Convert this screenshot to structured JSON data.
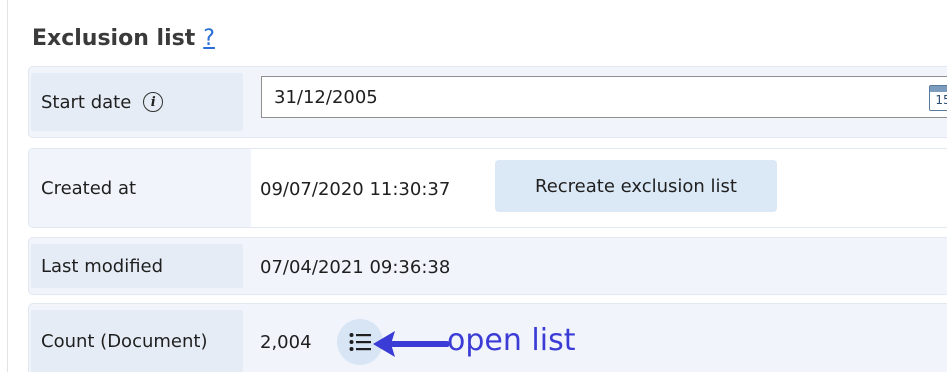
{
  "section": {
    "title": "Exclusion list",
    "help_link": "?"
  },
  "start_date": {
    "label": "Start date",
    "info_icon": "info-icon",
    "value": "31/12/2005",
    "calendar_day": "15"
  },
  "created": {
    "label": "Created at",
    "value": "09/07/2020 11:30:37",
    "button_label": "Recreate exclusion list"
  },
  "modified": {
    "label": "Last modified",
    "value": "07/04/2021 09:36:38"
  },
  "count": {
    "label": "Count (Document)",
    "value": "2,004",
    "list_icon": "list-icon"
  },
  "annotation": {
    "text": "open list",
    "color": "#3b3bd6"
  },
  "colors": {
    "row_background": "#f1f5fb",
    "label_background": "#e6ecf5",
    "button_background": "#dbe8f5",
    "link": "#2a6fd6"
  }
}
